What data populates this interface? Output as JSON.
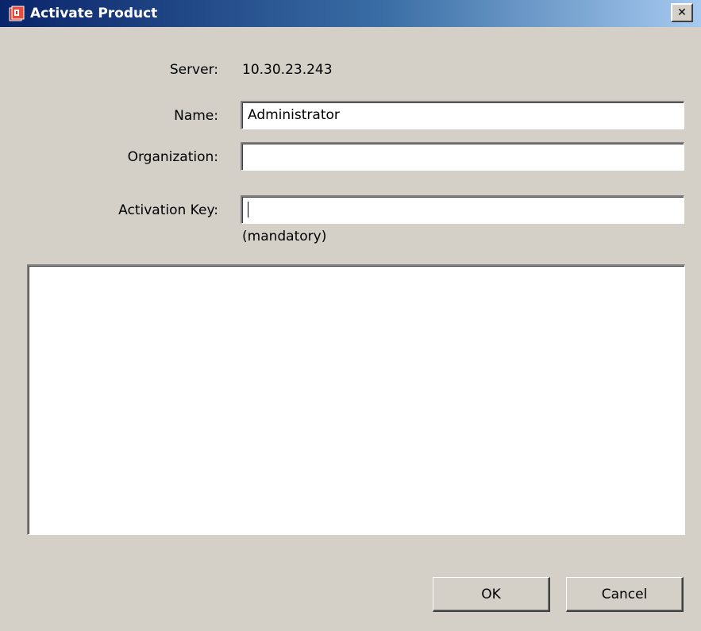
{
  "window": {
    "title": "Activate Product",
    "app_icon": "product-box-icon",
    "close_glyph": "✕"
  },
  "form": {
    "server_label": "Server:",
    "server_value": "10.30.23.243",
    "name_label": "Name:",
    "name_value": "Administrator",
    "organization_label": "Organization:",
    "organization_value": "",
    "activation_key_label": "Activation Key:",
    "activation_key_value": "",
    "activation_key_hint": "(mandatory)"
  },
  "message_area": {
    "value": ""
  },
  "buttons": {
    "ok_label": "OK",
    "cancel_label": "Cancel"
  },
  "colors": {
    "dialog_background": "#d4d0c8",
    "title_gradient_start": "#0a246a",
    "title_gradient_end": "#a6caf0",
    "title_text": "#ffffff"
  }
}
